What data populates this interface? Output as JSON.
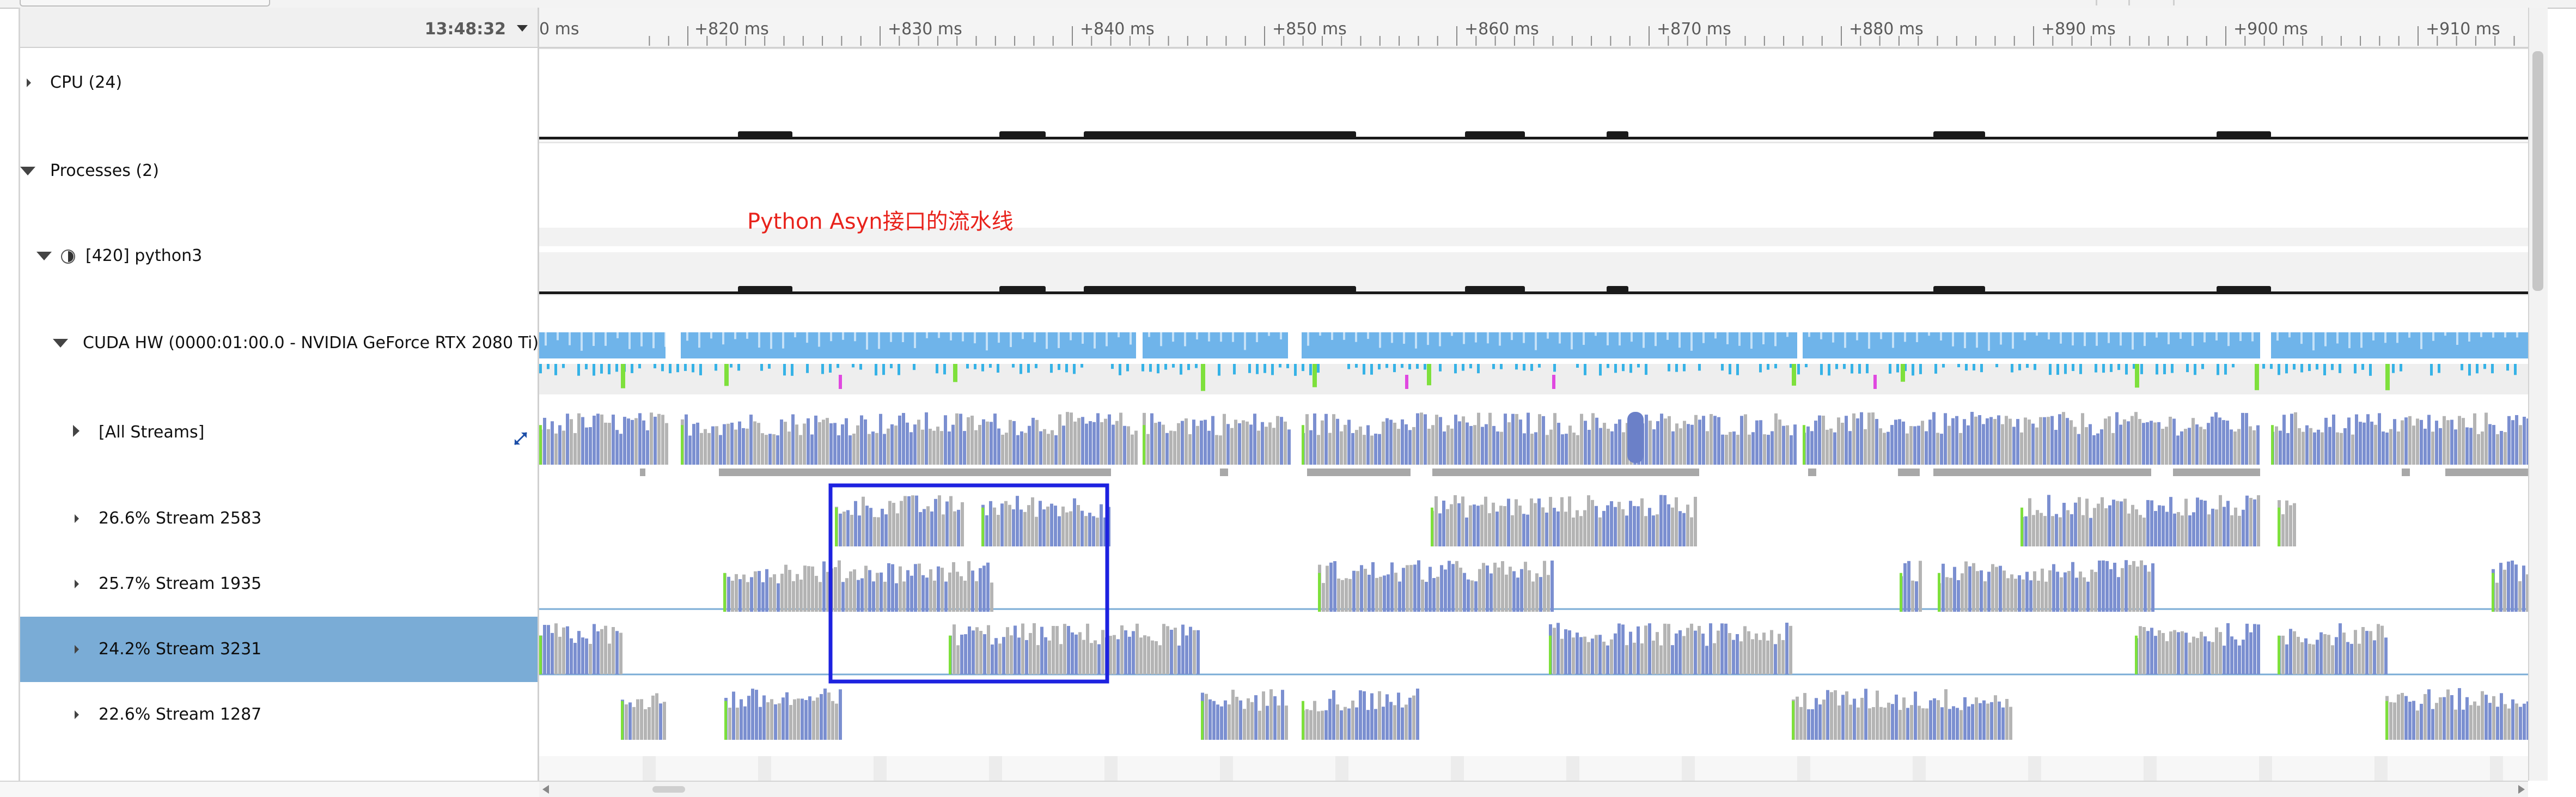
{
  "header": {
    "clock": "13:48:32"
  },
  "ruler": {
    "labels": [
      "0 ms",
      "+820 ms",
      "+830 ms",
      "+840 ms",
      "+850 ms",
      "+860 ms",
      "+870 ms",
      "+880 ms",
      "+890 ms",
      "+900 ms",
      "+910 ms"
    ]
  },
  "tree": {
    "cpu": "CPU (24)",
    "processes": "Processes (2)",
    "python": "[420] python3",
    "cuda": "CUDA HW (0000:01:00.0 - NVIDIA GeForce RTX 2080 Ti)",
    "all_streams": "[All Streams]",
    "streams": [
      "26.6% Stream 2583",
      "25.7% Stream 1935",
      "24.2% Stream 3231",
      "22.6% Stream 1287"
    ]
  },
  "annotation": {
    "text": "Python Asyn接口的流水线"
  },
  "colors": {
    "selection": "#7aacd6",
    "kernel_blue": "#7b8fd0",
    "kernel_gray": "#b4b4b4",
    "cuda_blue": "#6fb4ea",
    "marker_green": "#7ee03c",
    "marker_magenta": "#e048e0",
    "highlight_box": "#1d22e0",
    "annotation_red": "#e8231c"
  },
  "icons": [
    "triangle-right-icon",
    "triangle-down-icon",
    "process-icon",
    "expand-arrows-icon",
    "dropdown-caret-icon"
  ]
}
